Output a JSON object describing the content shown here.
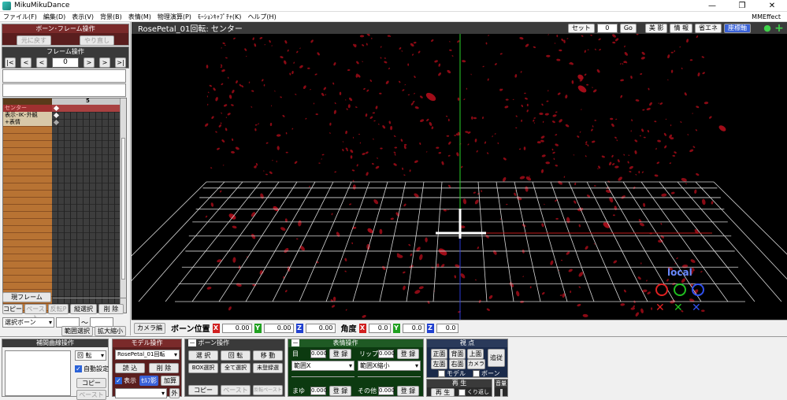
{
  "window": {
    "title": "MikuMikuDance",
    "minimize": "—",
    "maximize": "❐",
    "close": "✕"
  },
  "menu": [
    "ファイル(F)",
    "編集(D)",
    "表示(V)",
    "背景(B)",
    "表情(M)",
    "物理演算(P)",
    "ﾓｰｼｮﾝｷｬﾌﾟﾁｬ(K)",
    "ヘルプ(H)"
  ],
  "menu_right": "MMEffect",
  "bone_frame": {
    "title": "ボーン･フレーム操作",
    "undo": "元に戻す",
    "redo": "やり直し"
  },
  "frame_op": {
    "title": "フレーム操作",
    "first": "|<",
    "prev_key": "<",
    "prev": "<",
    "frame": "0",
    "next": ">",
    "next_key": ">",
    "last": ">|"
  },
  "timeline": {
    "header_number": "5",
    "bones": [
      {
        "label": "センター",
        "state": "selected"
      },
      {
        "label": "表示･IK･外観",
        "state": "group"
      },
      {
        "label": "+表情",
        "state": "group"
      }
    ]
  },
  "left_bottom": {
    "cur_frame": "現フレーム",
    "copy": "コピー",
    "paste": "ペースト",
    "reverse_paste": "反転P",
    "vertical_select": "縦選択",
    "delete": "削 除",
    "select_bone": "選択ボーン",
    "tilde": "～",
    "range_select": "範囲選択",
    "zoom": "拡大縮小"
  },
  "view": {
    "title": "RosePetal_01回転: センター",
    "set": "セット",
    "set_value": "0",
    "go": "Go",
    "shadow": "影",
    "shadow_prefix": "美",
    "info": "情 報",
    "eco": "省エネ",
    "axis": "座標軸",
    "zoom_icon": "magnifier-icon",
    "add_icon": "plus-icon",
    "local_label": "local"
  },
  "posbar": {
    "camera": "カメラ編",
    "bone_pos": "ボーン位置",
    "x": "X",
    "y": "Y",
    "z": "Z",
    "pos_x": "0.00",
    "pos_y": "0.00",
    "pos_z": "0.00",
    "angle": "角度",
    "ang_x": "0.0",
    "ang_y": "0.0",
    "ang_z": "0.0"
  },
  "interp": {
    "title": "補間曲線操作",
    "rotate": "回 転",
    "auto": "自動設定",
    "copy": "コピー",
    "paste": "ペースト"
  },
  "model": {
    "title": "モデル操作",
    "model_name": "RosePetal_01回転",
    "load": "読 込",
    "delete": "削 除",
    "show": "表示",
    "self_shadow": "ｾﾙﾌ影",
    "add": "加算",
    "outer": "外"
  },
  "bone_op": {
    "title": "ボーン操作",
    "select": "選 択",
    "rotate": "回 転",
    "move": "移 動",
    "box": "BOX選択",
    "all": "全て選択",
    "unreg": "未登録選",
    "copy": "コピー",
    "paste": "ペースト",
    "rev_paste": "反転ペースト"
  },
  "face": {
    "title": "表情操作",
    "eye": "目",
    "eye_val": "0.000",
    "lip": "リップ",
    "lip_val": "0.000",
    "reg": "登 録",
    "eye_sel": "範囲X",
    "lip_sel": "範囲X縮小",
    "brow": "まゆ",
    "brow_val": "0.000",
    "other": "その他",
    "other_val": "0.000"
  },
  "viewpoint": {
    "title": "視 点",
    "front": "正面",
    "back": "背面",
    "top": "上面",
    "left": "左面",
    "right": "右面",
    "camera": "カメラ",
    "follow": "追従",
    "model": "モデル",
    "bone": "ボーン"
  },
  "playback": {
    "title": "再 生",
    "play": "再 生",
    "repeat": "くり返し"
  },
  "volume": {
    "title": "音量"
  },
  "colors": {
    "accent_blue": "#3a62d8",
    "panel_red": "#7a2a2a",
    "petal": "#8a0a14"
  }
}
